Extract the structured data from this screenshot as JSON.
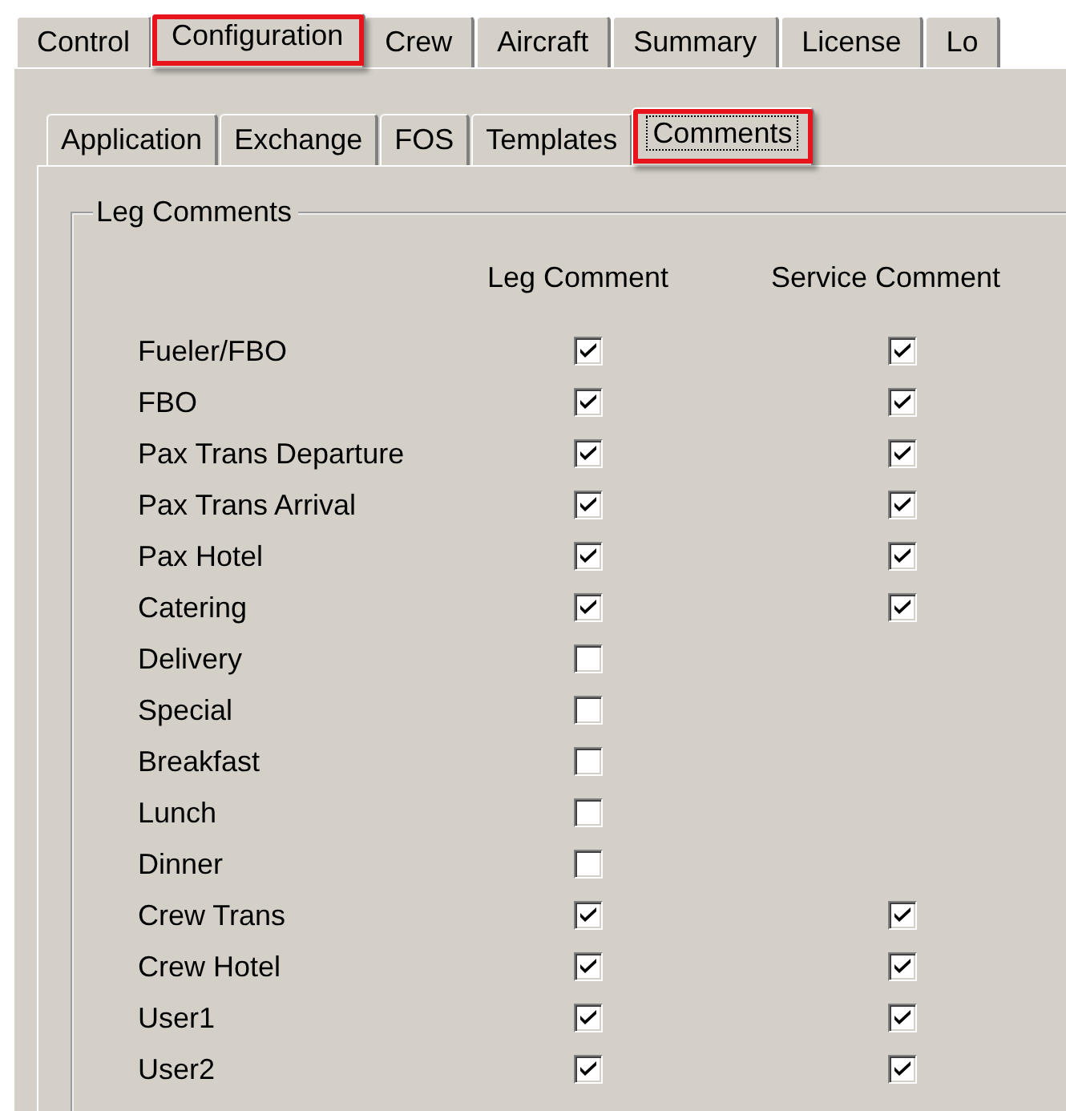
{
  "main_tabs": [
    {
      "label": "Control",
      "selected": false,
      "highlighted": false
    },
    {
      "label": "Configuration",
      "selected": true,
      "highlighted": true
    },
    {
      "label": "Crew",
      "selected": false,
      "highlighted": false
    },
    {
      "label": "Aircraft",
      "selected": false,
      "highlighted": false
    },
    {
      "label": "Summary",
      "selected": false,
      "highlighted": false
    },
    {
      "label": "License",
      "selected": false,
      "highlighted": false
    },
    {
      "label": "Lo",
      "selected": false,
      "highlighted": false
    }
  ],
  "sub_tabs": [
    {
      "label": "Application",
      "selected": false,
      "highlighted": false
    },
    {
      "label": "Exchange",
      "selected": false,
      "highlighted": false
    },
    {
      "label": "FOS",
      "selected": false,
      "highlighted": false
    },
    {
      "label": "Templates",
      "selected": false,
      "highlighted": false
    },
    {
      "label": "Comments",
      "selected": true,
      "highlighted": true
    }
  ],
  "group": {
    "title": "Leg Comments",
    "columns": [
      "Leg Comment",
      "Service Comment"
    ],
    "rows": [
      {
        "label": "Fueler/FBO",
        "kind": "both",
        "leg_checked": true,
        "service_checked": true
      },
      {
        "label": "FBO",
        "kind": "both",
        "leg_checked": true,
        "service_checked": true
      },
      {
        "label": "Pax Trans Departure",
        "kind": "both",
        "leg_checked": true,
        "service_checked": true
      },
      {
        "label": "Pax Trans Arrival",
        "kind": "both",
        "leg_checked": true,
        "service_checked": true
      },
      {
        "label": "Pax Hotel",
        "kind": "both",
        "leg_checked": true,
        "service_checked": true
      },
      {
        "label": "Catering",
        "kind": "both",
        "leg_checked": true,
        "service_checked": true
      },
      {
        "label": "Delivery",
        "kind": "leg_only",
        "leg_checked": false
      },
      {
        "label": "Special",
        "kind": "leg_only",
        "leg_checked": false
      },
      {
        "label": "Breakfast",
        "kind": "leg_only",
        "leg_checked": false
      },
      {
        "label": "Lunch",
        "kind": "leg_only",
        "leg_checked": false
      },
      {
        "label": "Dinner",
        "kind": "leg_only",
        "leg_checked": false
      },
      {
        "label": "Crew Trans",
        "kind": "both",
        "leg_checked": true,
        "service_checked": true
      },
      {
        "label": "Crew Hotel",
        "kind": "both",
        "leg_checked": true,
        "service_checked": true
      },
      {
        "label": "User1",
        "kind": "both",
        "leg_checked": true,
        "service_checked": true
      },
      {
        "label": "User2",
        "kind": "both",
        "leg_checked": true,
        "service_checked": true
      }
    ]
  }
}
